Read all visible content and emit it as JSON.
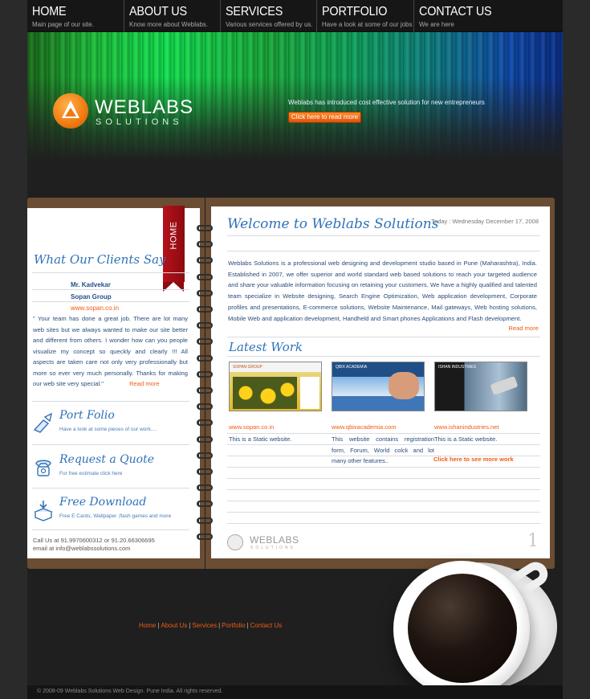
{
  "nav": {
    "items": [
      {
        "title": "HOME",
        "sub": "Main page of our site."
      },
      {
        "title": "ABOUT US",
        "sub": "Know more about Weblabs."
      },
      {
        "title": "SERVICES",
        "sub": "Various services offered by us."
      },
      {
        "title": "PORTFOLIO",
        "sub": "Have a look at some of our jobs"
      },
      {
        "title": "CONTACT US",
        "sub": "We are here"
      }
    ]
  },
  "hero": {
    "logo_main": "WEBLABS",
    "logo_sub": "SOLUTIONS",
    "tagline": "Weblabs has introduced cost effective solution   for new entrepreneurs",
    "button": "Click here to read more"
  },
  "left_page": {
    "tab_label": "HOME",
    "clients_title": "What Our Clients Say",
    "client_name": "Mr. Kadvekar",
    "client_company": "Sopan Group",
    "client_url": "www.sopan.co.in",
    "testimonial": "\" Your team has done a great job. There are lot many web sites but we always wanted to make our site better and different from others. I wonder how can you people visualize my concept so queckly and clearly !!! All aspects are taken care not only very professionally but more so ever very much personally. Thanks for making our web site very special.\"",
    "testimonial_more": "Read more",
    "blocks": [
      {
        "icon": "pen-hand-icon",
        "title": "Port Folio",
        "sub": "Have a look at some pieces of our work...."
      },
      {
        "icon": "phone-icon",
        "title": "Request a Quote",
        "sub": "For free estimate click here"
      },
      {
        "icon": "download-box-icon",
        "title": "Free Download",
        "sub": "Free E Cards, Wallpaper ,flash games and more"
      }
    ],
    "contact_line1": "Call Us at 91.9970600312 or 91.20.66306695",
    "contact_line2": "email at info@weblabssolutions.com"
  },
  "right_page": {
    "welcome_title": "Welcome to Weblabs Solutions",
    "today": "Today : Wednesday December 17, 2008",
    "intro": "Weblabs Solutions is a professional web designing and development studio based in Pune (Maharashtra), India. Established in 2007, we offer superior and world standard web based solutions to reach your targeted audience and share your valuable information focusing on retaining your customers. We have a highly qualified and talented team specialize in Website designing, Search Engine Optimization, Web application development, Corporate profiles and presentations, E-commerce solutions, Website Maintenance, Mail gateways, Web hosting solutions, Mobile Web and application development, Handheld and Smart phones Applications and Flash development.",
    "intro_more": "Read more",
    "latest_title": "Latest Work",
    "works": [
      {
        "url": "www.sopan.co.in",
        "desc": "This is a Static website.",
        "thumb_label": "SOPAN GROUP"
      },
      {
        "url": "www.qbixacademia.com",
        "desc": "This website contains registration form, Forum, World colck and lot many other features..",
        "thumb_label": "QBIX ACADEMIA"
      },
      {
        "url": "www.ishanindustries.net",
        "desc": "This is a Static website.",
        "thumb_label": "ISHAN INDUSTRIES"
      }
    ],
    "see_more": "Click here to see more work",
    "page_number": "1",
    "footer_logo": "WEBLABS",
    "footer_logo_sub": "SOLUTIONS"
  },
  "footer": {
    "links": [
      "Home",
      "About Us",
      "Services",
      "Portfolio",
      "Contact Us"
    ],
    "copyright": "© 2008-09 Weblabs Solutions Web Design. Pune India. All rights reserved."
  },
  "colors": {
    "accent_orange": "#ef5b14",
    "text_blue": "#2a4c7c",
    "script_blue": "#2f72b8",
    "tab_red": "#b5121b"
  }
}
